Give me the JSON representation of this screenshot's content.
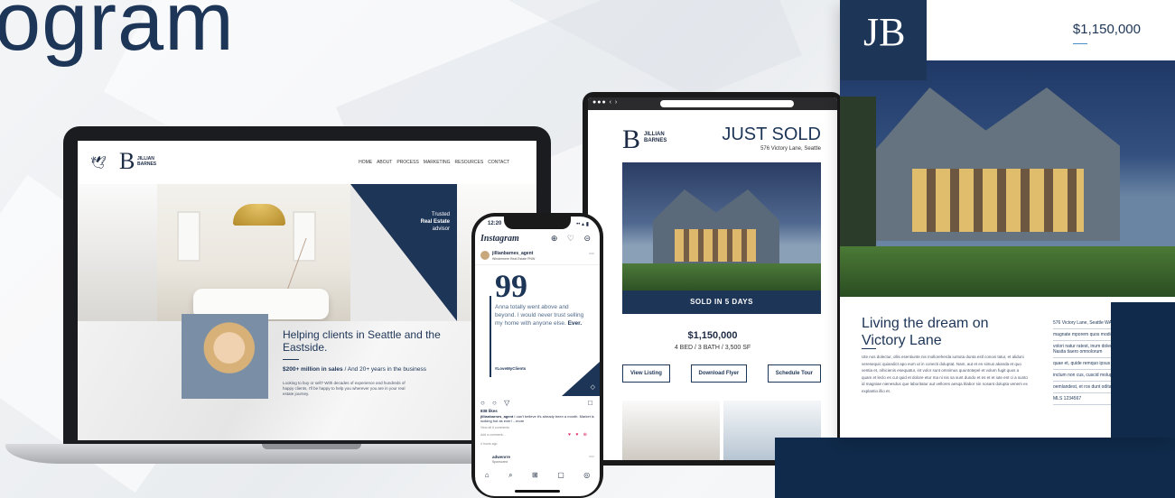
{
  "headline": "ogram",
  "laptop_site": {
    "logo_name": "JILLIAN BARNES",
    "nav": [
      "HOME",
      "ABOUT",
      "PROCESS",
      "MARKETING",
      "RESOURCES",
      "CONTACT"
    ],
    "trusted_prefix": "Trusted",
    "trusted_bold": "Real Estate",
    "trusted_suffix": "advisor",
    "hero_title": "Helping clients in Seattle and the Eastside.",
    "stat_bold": "$200+ million in sales",
    "stat_rest": " / And 20+ years in the business",
    "body": "Looking to buy or sell? With decades of experience and hundreds of happy clients, I'll be happy to help you wherever you are in your real estate journey."
  },
  "phone": {
    "time": "12:20",
    "status": "•• ▴ ▮",
    "brand": "Instagram",
    "header_icons": "⊕ ♡ ⊝",
    "user": "jillianbarnes_agent",
    "user_sub": "Windermere Real Estate PNW",
    "more": "⋯",
    "quote_mark": "99",
    "testimonial_plain": "Anna totally went above and beyond. I would never trust selling my home with anyone else. ",
    "testimonial_bold": "Ever.",
    "hashtag": "#LoveMyClients",
    "actions": "○ ○ ▽",
    "bookmark": "□",
    "likes": "838 likes",
    "caption_user": "jillianbarnes_agent",
    "caption": " I can't believe it's already been a month. Market is looking hot as ever! ...more",
    "comments": "View all 6 comments",
    "add_comment": "Add a comment...",
    "reactions": "♥ ♥ ⊕",
    "ago": "4 hours ago",
    "ad_user": "adwenrre",
    "ad_sub": "Sponsored",
    "tabs": [
      "⌂",
      "⌕",
      "⊞",
      "▢",
      "◎"
    ]
  },
  "tablet": {
    "dots": "●●● ‹ ›",
    "logo_name": "JILLIAN BARNES",
    "heading": "JUST SOLD",
    "address": "576 Victory Lane, Seattle",
    "band": "SOLD IN 5 DAYS",
    "price": "$1,150,000",
    "specs": "4 BED / 3 BATH / 3,500 SF",
    "buttons": [
      "View Listing",
      "Download Flyer",
      "Schedule Tour"
    ]
  },
  "flyer": {
    "logo": "JB",
    "price": "$1,150,000",
    "title": "Living the dream on Victory Lane",
    "body": "Ute nos dolectur, ollis esentiunte nis molloreherda iuntota dunta estl conovi tatur, et aliduni veresequic quiandict apo eum ut in conecti doluptat. Nam, aut et es simus akanda et quo ventia et, nihicienis esequatur, int volor sunt omnimus quuntotepel et volum fugit quos a quam et leclo es cut quid et dolore etur ma ni nis sa sunt dundo et es et et iute ent ci a sunto id magniae nienesdus que laboritatur aut vellores aesqa blabor sin nosant dolupta venem ex explantio illio et.",
    "details": [
      "576 Victory Lane, Seattle WA",
      "magnate mporem quos modicilla",
      "volori natur ratest, inum dolenim olecupo es dis ent. Nasita tiaero omnolorum",
      "quae et, quide remquo ipsus",
      "inctum non cus, cuscid molupta",
      "oemlandest, et ros dunt odita",
      "MLS 1234567"
    ]
  }
}
